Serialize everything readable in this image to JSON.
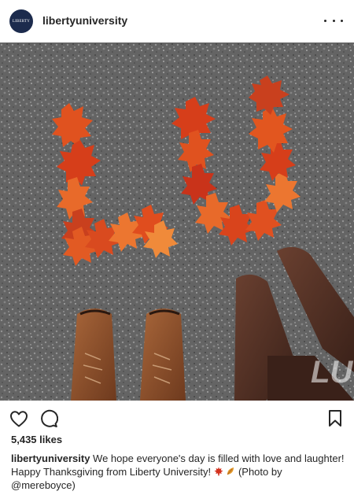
{
  "post": {
    "username": "libertyuniversity",
    "avatar_text": "LIBERTY",
    "likes": "5,435 likes",
    "caption": {
      "user": "libertyuniversity",
      "text_part1": " We hope everyone's day is filled with love and laughter! Happy Thanksgiving from Liberty University! ",
      "text_part2": " (Photo by ",
      "mention": "@mereboyce",
      "text_part3": ")"
    },
    "photo": {
      "watermark_text": "LU"
    },
    "icons": {
      "more": "more-options-icon",
      "like": "heart-icon",
      "comment": "comment-icon",
      "save": "bookmark-icon",
      "emoji1": "maple-leaf-icon",
      "emoji2": "fallen-leaf-icon"
    },
    "colors": {
      "avatar_bg": "#1c2b4d",
      "asphalt": "#6b6b6b",
      "leaf": "#d9471c",
      "boot_light": "#8a4f2c",
      "boot_dark": "#4a2c21"
    }
  }
}
